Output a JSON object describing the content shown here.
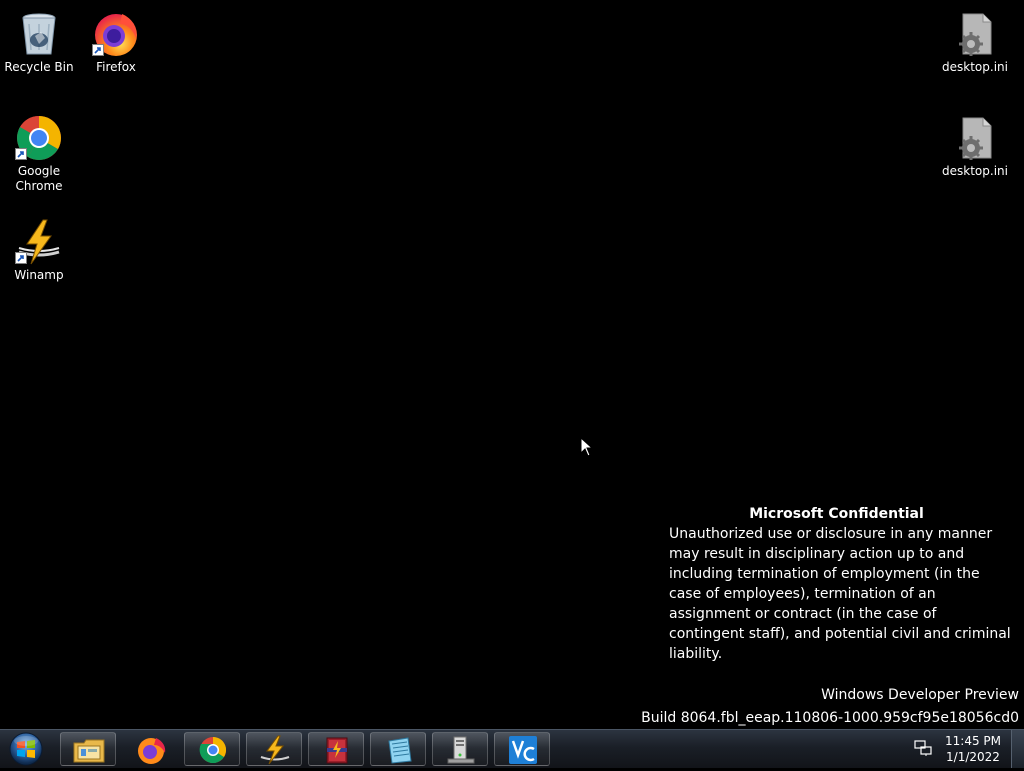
{
  "desktop": {
    "icons": [
      {
        "label": "Recycle Bin",
        "icon": "recycle-bin-icon"
      },
      {
        "label": "Firefox",
        "icon": "firefox-icon"
      },
      {
        "label": "Google Chrome",
        "icon": "chrome-icon"
      },
      {
        "label": "Winamp",
        "icon": "winamp-icon"
      },
      {
        "label": "desktop.ini",
        "icon": "settings-file-icon"
      },
      {
        "label": "desktop.ini",
        "icon": "settings-file-icon"
      }
    ]
  },
  "notice": {
    "title": "Microsoft Confidential",
    "body": "Unauthorized use or disclosure in any manner may result in disciplinary action up to and including termination of employment (in the case of employees), termination of an assignment or contract (in the case of contingent staff), and potential civil and criminal liability."
  },
  "watermark": {
    "line1": "Windows Developer Preview",
    "line2": "Build 8064.fbl_eeap.110806-1000.959cf95e18056cd0"
  },
  "taskbar": {
    "start_icon": "windows-logo-icon",
    "items": [
      {
        "icon": "file-explorer-icon"
      },
      {
        "icon": "firefox-icon"
      },
      {
        "icon": "chrome-icon"
      },
      {
        "icon": "winamp-icon"
      },
      {
        "icon": "winrar-icon"
      },
      {
        "icon": "notepad-icon"
      },
      {
        "icon": "server-icon"
      },
      {
        "icon": "vc-icon"
      }
    ],
    "tray": {
      "time": "11:45 PM",
      "date": "1/1/2022"
    }
  },
  "colors": {
    "desktop_bg": "#000000",
    "taskbar_bg": "#1a1f27",
    "text": "#ffffff"
  }
}
